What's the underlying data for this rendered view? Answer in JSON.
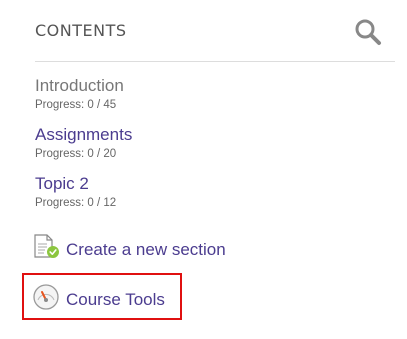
{
  "header": {
    "title": "CONTENTS",
    "search_icon": "search-icon"
  },
  "sections": [
    {
      "title": "Introduction",
      "progress": "Progress: 0 / 45",
      "style": "dim"
    },
    {
      "title": "Assignments",
      "progress": "Progress: 0 / 20",
      "style": "link"
    },
    {
      "title": "Topic 2",
      "progress": "Progress: 0 / 12",
      "style": "link"
    }
  ],
  "actions": {
    "create_section": {
      "label": "Create a new section",
      "icon": "new-section-icon"
    },
    "course_tools": {
      "label": "Course Tools",
      "icon": "gauge-icon"
    }
  },
  "colors": {
    "link": "#4b3c8f",
    "dim_title": "#777777",
    "highlight": "#e01010",
    "accent_green": "#8cc63f",
    "gauge_needle": "#e8541e"
  }
}
